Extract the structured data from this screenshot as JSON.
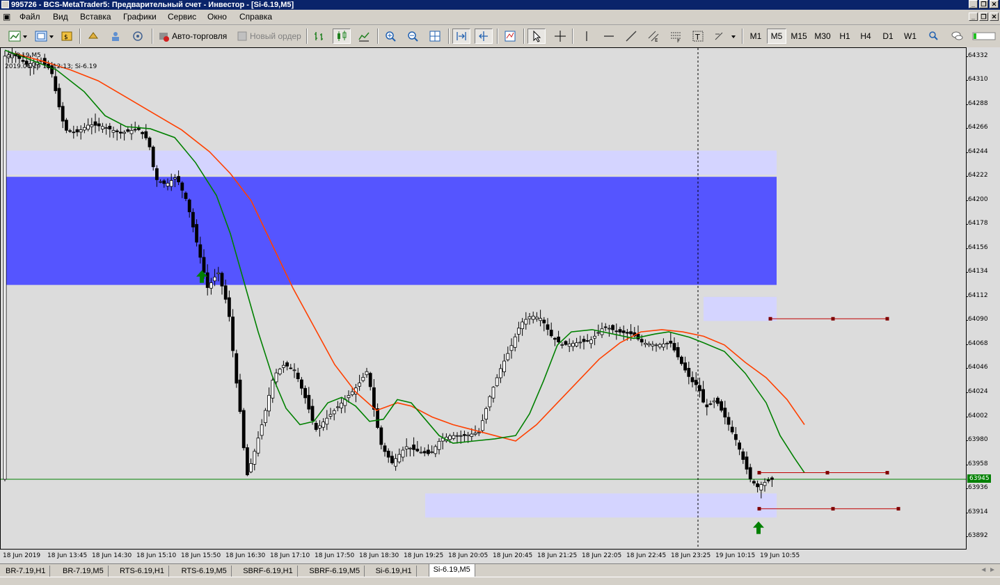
{
  "window": {
    "title": "995726 - BCS-MetaTrader5: Предварительный счет - Инвестор - [Si-6.19,M5]"
  },
  "menu": {
    "items": [
      "Файл",
      "Вид",
      "Вставка",
      "Графики",
      "Сервис",
      "Окно",
      "Справка"
    ]
  },
  "toolbar": {
    "auto_trading_label": "Авто-торговля",
    "new_order_label": "Новый ордер",
    "timeframes": [
      "M1",
      "M5",
      "M15",
      "M30",
      "H1",
      "H4",
      "D1",
      "W1"
    ],
    "active_timeframe": "M5"
  },
  "chart": {
    "symbol_label": "Si-6.19,M5",
    "info_label": "2019.06.19 11:12:13; Si-6.19",
    "current_price": "63945",
    "price_ticks": [
      "64332",
      "64310",
      "64288",
      "64266",
      "64244",
      "64222",
      "64200",
      "64178",
      "64156",
      "64134",
      "64112",
      "64090",
      "64068",
      "64046",
      "64024",
      "64002",
      "63980",
      "63958",
      "63936",
      "63914",
      "63892"
    ],
    "time_ticks": [
      "18 Jun 2019",
      "18 Jun 13:45",
      "18 Jun 14:30",
      "18 Jun 15:10",
      "18 Jun 15:50",
      "18 Jun 16:30",
      "18 Jun 17:10",
      "18 Jun 17:50",
      "18 Jun 18:30",
      "18 Jun 19:25",
      "18 Jun 20:05",
      "18 Jun 20:45",
      "18 Jun 21:25",
      "18 Jun 22:05",
      "18 Jun 22:45",
      "18 Jun 23:25",
      "19 Jun 10:15",
      "19 Jun 10:55"
    ],
    "colors": {
      "bg": "#dcdcdc",
      "zone_dark": "#5555ff",
      "zone_light": "#d4d4ff",
      "ma_fast": "#008000",
      "ma_slow": "#ff4000",
      "level_line": "#c00000",
      "price_line": "#008000",
      "arrow": "#008000"
    }
  },
  "chart_data": {
    "type": "candlestick",
    "symbol": "Si-6.19",
    "timeframe": "M5",
    "ylim": [
      63880,
      64340
    ],
    "current_price": 63945,
    "zones": [
      {
        "from": 64224,
        "to": 64246,
        "kind": "light"
      },
      {
        "from": 64123,
        "to": 64222,
        "kind": "dark"
      },
      {
        "from": 64090,
        "to": 64112,
        "kind": "light"
      },
      {
        "from": 63910,
        "to": 63932,
        "kind": "light"
      }
    ],
    "levels": [
      64092,
      63951,
      63918
    ],
    "buy_arrows": [
      64130,
      63900
    ]
  },
  "tabs": {
    "items": [
      "BR-7.19,H1",
      "BR-7.19,M5",
      "RTS-6.19,H1",
      "RTS-6.19,M5",
      "SBRF-6.19,H1",
      "SBRF-6.19,M5",
      "Si-6.19,H1",
      "Si-6.19,M5"
    ],
    "active": "Si-6.19,M5"
  }
}
